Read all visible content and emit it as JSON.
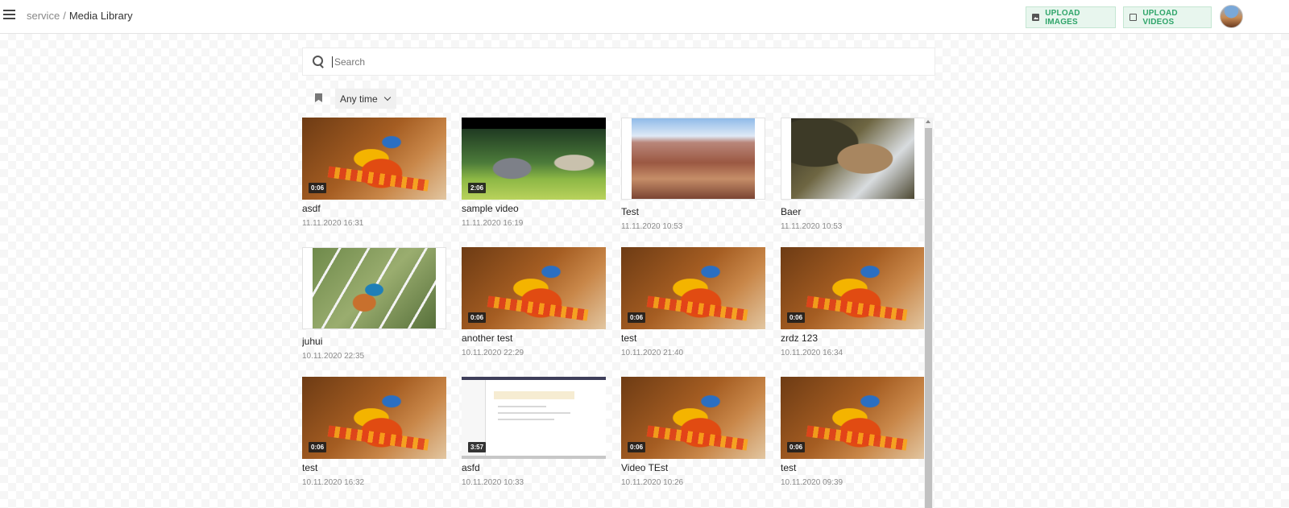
{
  "header": {
    "breadcrumb_root": "service",
    "breadcrumb_separator": "/",
    "breadcrumb_current": "Media Library",
    "upload_images_label": "UPLOAD IMAGES",
    "upload_videos_label": "UPLOAD VIDEOS"
  },
  "search": {
    "placeholder": "Search",
    "value": ""
  },
  "filters": {
    "time_selected": "Any time"
  },
  "colors": {
    "accent": "#2fa56a",
    "accent_bg": "#e8f6ee"
  },
  "media": [
    {
      "name": "asdf",
      "date": "11.11.2020 16:31",
      "type": "video",
      "duration": "0:06",
      "thumb": "robot"
    },
    {
      "name": "sample video",
      "date": "11.11.2020 16:19",
      "type": "video",
      "duration": "2:06",
      "thumb": "bunny"
    },
    {
      "name": "Test",
      "date": "11.11.2020 10:53",
      "type": "image",
      "thumb": "canyon"
    },
    {
      "name": "Baer",
      "date": "11.11.2020 10:53",
      "type": "image",
      "thumb": "bear"
    },
    {
      "name": "juhui",
      "date": "10.11.2020 22:35",
      "type": "image",
      "thumb": "bird"
    },
    {
      "name": "another test",
      "date": "10.11.2020 22:29",
      "type": "video",
      "duration": "0:06",
      "thumb": "robot"
    },
    {
      "name": "test",
      "date": "10.11.2020 21:40",
      "type": "video",
      "duration": "0:06",
      "thumb": "robot"
    },
    {
      "name": "zrdz 123",
      "date": "10.11.2020 16:34",
      "type": "video",
      "duration": "0:06",
      "thumb": "robot"
    },
    {
      "name": "test",
      "date": "10.11.2020 16:32",
      "type": "video",
      "duration": "0:06",
      "thumb": "robot"
    },
    {
      "name": "asfd",
      "date": "10.11.2020 10:33",
      "type": "video",
      "duration": "3:57",
      "thumb": "screen"
    },
    {
      "name": "Video TEst",
      "date": "10.11.2020 10:26",
      "type": "video",
      "duration": "0:06",
      "thumb": "robot"
    },
    {
      "name": "test",
      "date": "10.11.2020 09:39",
      "type": "video",
      "duration": "0:06",
      "thumb": "robot"
    }
  ]
}
